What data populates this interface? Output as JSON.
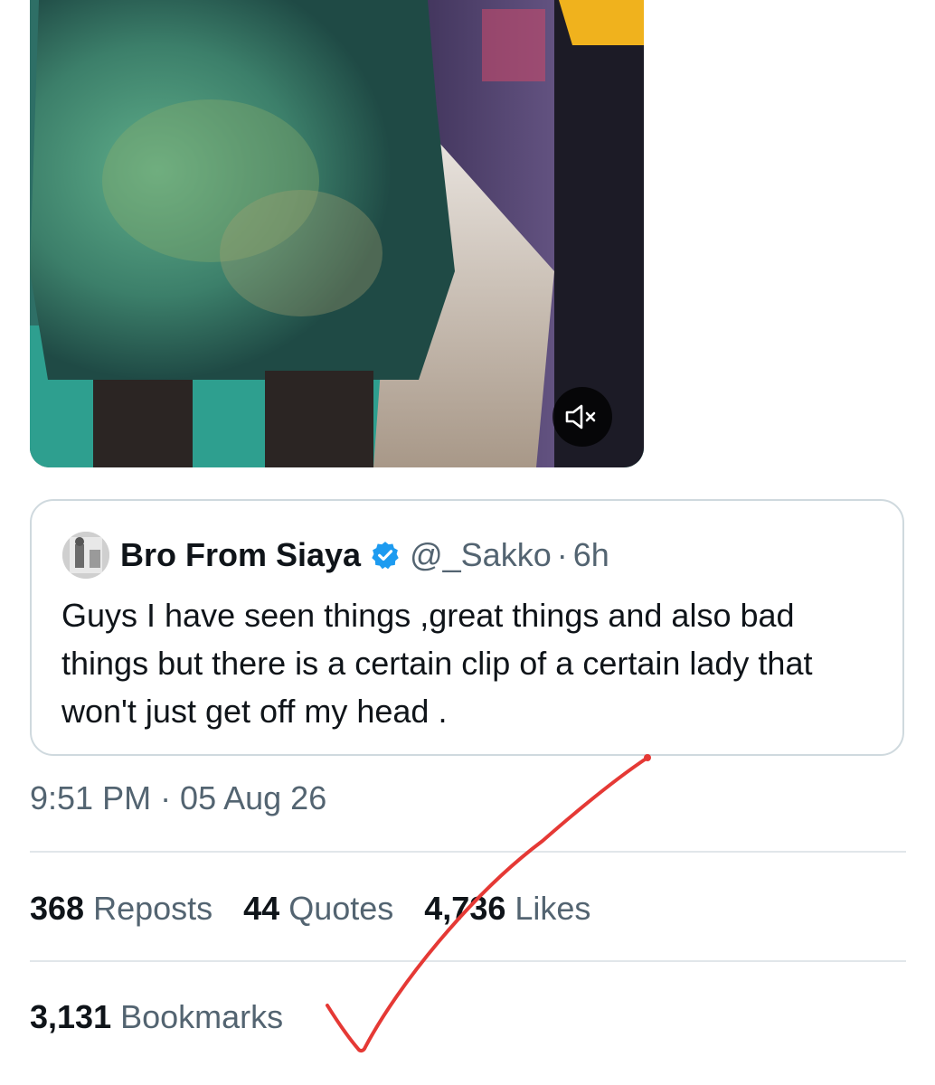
{
  "media": {
    "icon": "volume-mute-icon",
    "type": "video"
  },
  "quoted_tweet": {
    "display_name": "Bro From Siaya",
    "verified_icon": "verified-badge-icon",
    "handle": "@_Sakko",
    "separator": "·",
    "time": "6h",
    "text": "Guys I have seen things ,great things and also bad things but there is a certain clip of a certain lady that won't just get off my head ."
  },
  "tweet": {
    "timestamp": "9:51 PM · 05 Aug 26"
  },
  "stats": {
    "reposts_count": "368",
    "reposts_label": "Reposts",
    "quotes_count": "44",
    "quotes_label": "Quotes",
    "likes_count": "4,736",
    "likes_label": "Likes",
    "bookmarks_count": "3,131",
    "bookmarks_label": "Bookmarks"
  },
  "colors": {
    "primary_text": "#0f1419",
    "secondary_text": "#536471",
    "verified_blue": "#1d9bf0",
    "annotation_red": "#e53935"
  }
}
